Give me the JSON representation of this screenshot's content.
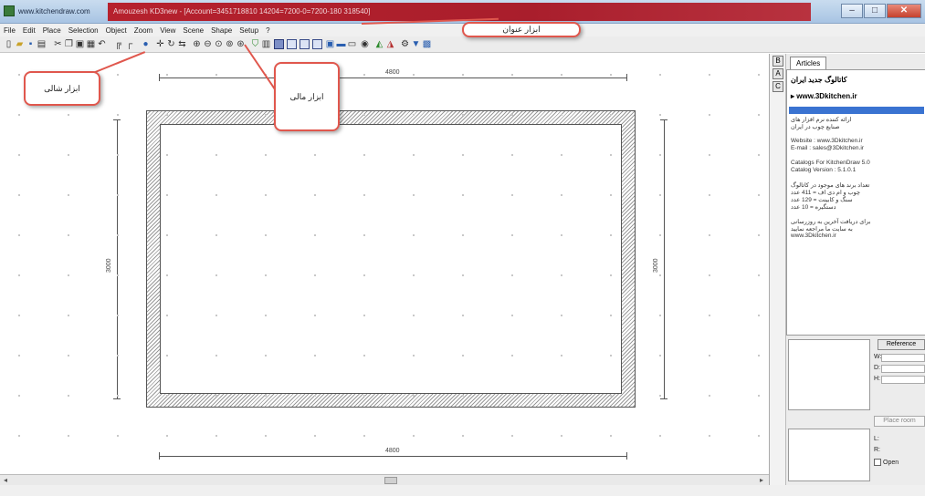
{
  "window": {
    "site": "www.kitchendraw.com",
    "title_highlight": "Amouzesh KD3new - [Account=3451718810 14204=7200-0=7200-180 318540]",
    "minimize": "–",
    "maximize": "□",
    "close": "✕"
  },
  "menu": [
    "File",
    "Edit",
    "Place",
    "Selection",
    "Object",
    "Zoom",
    "View",
    "Scene",
    "Shape",
    "Setup",
    "?"
  ],
  "dimensions": {
    "top": "4800",
    "bottom": "4800",
    "left": "3000",
    "right": "3000"
  },
  "callouts": {
    "title_bar": "ابزار عنوان",
    "horizontal_toolbar": "ابزار شالی",
    "main_toolbar": "ابزار مالی"
  },
  "panel": {
    "tab": "Articles",
    "heading": "کاتالوگ جدید ایران",
    "link": "www.3Dkitchen.ir",
    "lines": [
      "ارائه کننده نرم افزار های",
      "صنایع چوب در ایران",
      "",
      "Website : www.3Dkitchen.ir",
      "E-mail : sales@3Dkitchen.ir",
      "",
      "Catalogs For KitchenDraw 5.0",
      "Catalog Version : 5.1.0.1",
      "",
      "تعداد برند های موجود در کاتالوگ",
      "چوب و ام دی اف = 411 عدد",
      "سنگ و کابینت = 129 عدد",
      "دستگیره = 10 عدد",
      "",
      "برای دریافت آخرین به روزرسانی",
      "به سایت ما مراجعه نمایید",
      "www.3Dkitchen.ir"
    ],
    "reference_button": "Reference",
    "fields": [
      "W:",
      "D:",
      "H:"
    ],
    "place_button": "Place room",
    "l_label": "L:",
    "r_label": "R:",
    "open_label": "Open"
  }
}
